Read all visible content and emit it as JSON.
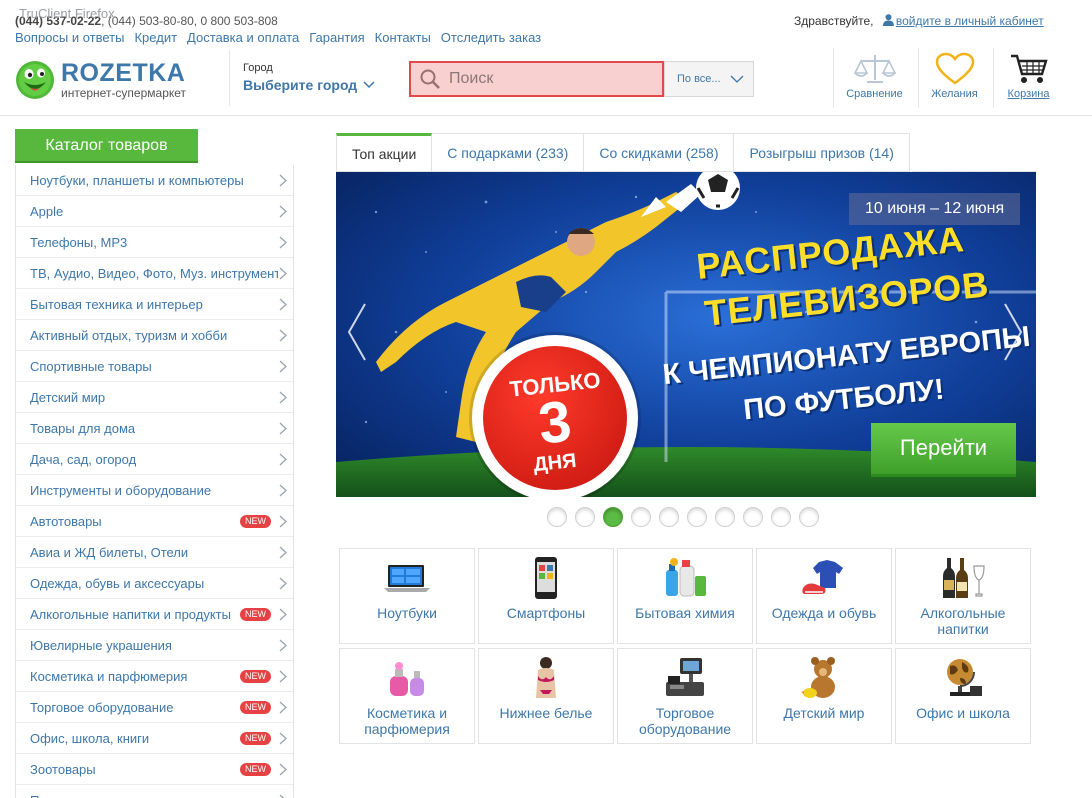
{
  "browser": {
    "overlay_label": "TruClient Firefox"
  },
  "header": {
    "phone_bold": "(044) 537-02-22",
    "phones_rest": ", (044) 503-80-80, 0 800 503-808",
    "greeting": "Здравствуйте,",
    "login_link": "войдите в личный кабинет",
    "nav": [
      "Вопросы и ответы",
      "Кредит",
      "Доставка и оплата",
      "Гарантия",
      "Контакты",
      "Отследить заказ"
    ],
    "logo": {
      "brand": "ROZETKA",
      "tagline": "интернет-супермаркет"
    },
    "city": {
      "label": "Город",
      "value": "Выберите город"
    },
    "search": {
      "placeholder": "Поиск",
      "scope": "По все..."
    },
    "actions": {
      "compare": "Сравнение",
      "wishlist": "Желания",
      "cart": "Корзина"
    }
  },
  "catalog": {
    "button": "Каталог товаров",
    "new_badge": "NEW",
    "items": [
      {
        "label": "Ноутбуки, планшеты и компьютеры",
        "is_new": false
      },
      {
        "label": "Apple",
        "is_new": false
      },
      {
        "label": "Телефоны, MP3",
        "is_new": false
      },
      {
        "label": "ТВ, Аудио, Видео, Фото, Муз. инструменты",
        "is_new": false
      },
      {
        "label": "Бытовая техника и интерьер",
        "is_new": false
      },
      {
        "label": "Активный отдых, туризм и хобби",
        "is_new": false
      },
      {
        "label": "Спортивные товары",
        "is_new": false
      },
      {
        "label": "Детский мир",
        "is_new": false
      },
      {
        "label": "Товары для дома",
        "is_new": false
      },
      {
        "label": "Дача, сад, огород",
        "is_new": false
      },
      {
        "label": "Инструменты и оборудование",
        "is_new": false
      },
      {
        "label": "Автотовары",
        "is_new": true
      },
      {
        "label": "Авиа и ЖД билеты, Отели",
        "is_new": false
      },
      {
        "label": "Одежда, обувь и аксессуары",
        "is_new": false
      },
      {
        "label": "Алкогольные напитки и продукты",
        "is_new": true
      },
      {
        "label": "Ювелирные украшения",
        "is_new": false
      },
      {
        "label": "Косметика и парфюмерия",
        "is_new": true
      },
      {
        "label": "Торговое оборудование",
        "is_new": true
      },
      {
        "label": "Офис, школа, книги",
        "is_new": true
      },
      {
        "label": "Зоотовары",
        "is_new": true
      },
      {
        "label": "Подарки",
        "is_new": false
      }
    ]
  },
  "tabs": [
    {
      "label": "Топ акции",
      "active": true
    },
    {
      "label": "С подарками (233)",
      "active": false
    },
    {
      "label": "Со скидками (258)",
      "active": false
    },
    {
      "label": "Розыгрыш призов (14)",
      "active": false
    }
  ],
  "banner": {
    "date": "10 июня – 12 июня",
    "title_line1": "РАСПРОДАЖА",
    "title_line2": "ТЕЛЕВИЗОРОВ",
    "sub_line1": "К ЧЕМПИОНАТУ ЕВРОПЫ",
    "sub_line2": "ПО ФУТБОЛУ!",
    "badge_top": "ТОЛЬКО",
    "badge_num": "3",
    "badge_bottom": "ДНЯ",
    "cta": "Перейти"
  },
  "carousel": {
    "total": 10,
    "active_index": 2
  },
  "tiles": [
    {
      "label": "Ноутбуки",
      "icon": "laptop-icon"
    },
    {
      "label": "Смартфоны",
      "icon": "smartphone-icon"
    },
    {
      "label": "Бытовая химия",
      "icon": "household-chemicals-icon"
    },
    {
      "label": "Одежда и обувь",
      "icon": "clothing-icon"
    },
    {
      "label": "Алкогольные напитки",
      "icon": "bottles-icon"
    },
    {
      "label": "Косметика и парфюмерия",
      "icon": "perfume-icon"
    },
    {
      "label": "Нижнее белье",
      "icon": "lingerie-icon"
    },
    {
      "label": "Торговое оборудование",
      "icon": "cash-register-icon"
    },
    {
      "label": "Детский мир",
      "icon": "teddy-bear-icon"
    },
    {
      "label": "Офис и школа",
      "icon": "globe-icon"
    }
  ],
  "colors": {
    "link": "#3e77aa",
    "green": "#57b83d",
    "search_border": "#e2494a",
    "badge_red": "#e74243"
  }
}
